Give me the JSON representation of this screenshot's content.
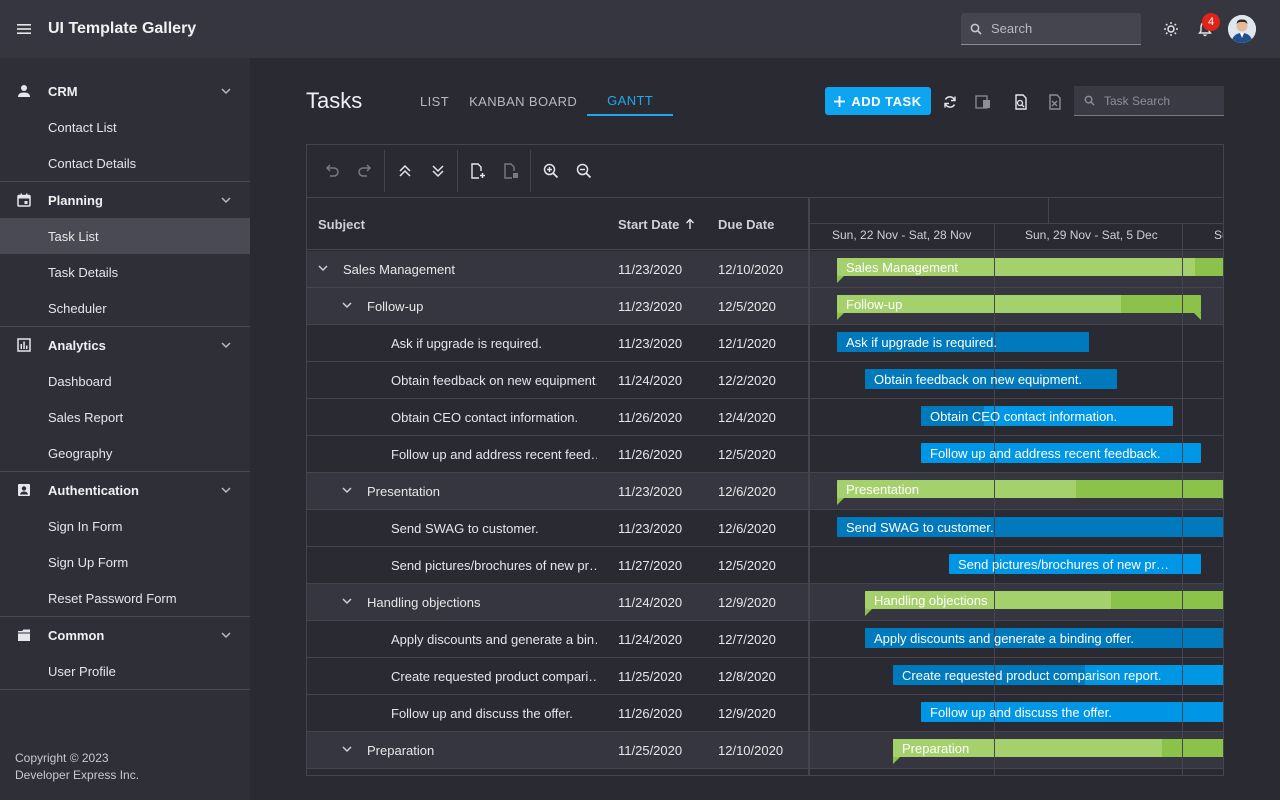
{
  "app": {
    "title": "UI Template Gallery",
    "search_placeholder": "Search",
    "notification_count": "4"
  },
  "sidebar": {
    "groups": [
      {
        "label": "CRM",
        "icon": "person-icon",
        "items": [
          {
            "label": "Contact List"
          },
          {
            "label": "Contact Details"
          }
        ]
      },
      {
        "label": "Planning",
        "icon": "calendar-icon",
        "items": [
          {
            "label": "Task List",
            "active": true
          },
          {
            "label": "Task Details"
          },
          {
            "label": "Scheduler"
          }
        ]
      },
      {
        "label": "Analytics",
        "icon": "chart-icon",
        "items": [
          {
            "label": "Dashboard"
          },
          {
            "label": "Sales Report"
          },
          {
            "label": "Geography"
          }
        ]
      },
      {
        "label": "Authentication",
        "icon": "account-box-icon",
        "items": [
          {
            "label": "Sign In Form"
          },
          {
            "label": "Sign Up Form"
          },
          {
            "label": "Reset Password Form"
          }
        ]
      },
      {
        "label": "Common",
        "icon": "folder-icon",
        "items": [
          {
            "label": "User Profile"
          }
        ]
      }
    ],
    "footer_line1": "Copyright © 2023",
    "footer_line2": "Developer Express Inc."
  },
  "page": {
    "title": "Tasks",
    "tabs": [
      {
        "label": "LIST"
      },
      {
        "label": "KANBAN BOARD"
      },
      {
        "label": "GANTT",
        "active": true
      }
    ],
    "add_task_label": "ADD TASK",
    "task_search_placeholder": "Task Search"
  },
  "gantt": {
    "columns": {
      "subject": "Subject",
      "start": "Start Date",
      "due": "Due Date"
    },
    "weeks": [
      "Sun, 22 Nov - Sat, 28 Nov",
      "Sun, 29 Nov - Sat, 5 Dec",
      "Su"
    ],
    "rows": [
      {
        "subject": "Sales Management",
        "start": "11/23/2020",
        "due": "12/10/2020",
        "level": 0,
        "summary": true,
        "bar_label": "Sales Management",
        "progress": 0.71
      },
      {
        "subject": "Follow-up",
        "start": "11/23/2020",
        "due": "12/5/2020",
        "level": 1,
        "summary": true,
        "bar_label": "Follow-up",
        "progress": 0.78
      },
      {
        "subject": "Ask if upgrade is required.",
        "start": "11/23/2020",
        "due": "12/1/2020",
        "level": 2,
        "summary": false,
        "bar_label": "Ask if upgrade is required.",
        "progress": 1.0
      },
      {
        "subject": "Obtain feedback on new equipment.",
        "start": "11/24/2020",
        "due": "12/2/2020",
        "level": 2,
        "summary": false,
        "bar_label": "Obtain feedback on new equipment.",
        "progress": 1.0
      },
      {
        "subject": "Obtain CEO contact information.",
        "start": "11/26/2020",
        "due": "12/4/2020",
        "level": 2,
        "summary": false,
        "bar_label": "Obtain CEO contact information.",
        "progress": 0.25
      },
      {
        "subject": "Follow up and address recent feed…",
        "start": "11/26/2020",
        "due": "12/5/2020",
        "level": 2,
        "summary": false,
        "bar_label": "Follow up and address recent feedback.",
        "progress": 0.0
      },
      {
        "subject": "Presentation",
        "start": "11/23/2020",
        "due": "12/6/2020",
        "level": 1,
        "summary": true,
        "bar_label": "Presentation",
        "progress": 0.61
      },
      {
        "subject": "Send SWAG to customer.",
        "start": "11/23/2020",
        "due": "12/6/2020",
        "level": 2,
        "summary": false,
        "bar_label": "Send SWAG to customer.",
        "progress": 1.0
      },
      {
        "subject": "Send pictures/brochures of new pr…",
        "start": "11/27/2020",
        "due": "12/5/2020",
        "level": 2,
        "summary": false,
        "bar_label": "Send pictures/brochures of new pr…",
        "progress": 0.0
      },
      {
        "subject": "Handling objections",
        "start": "11/24/2020",
        "due": "12/9/2020",
        "level": 1,
        "summary": true,
        "bar_label": "Handling objections",
        "progress": 0.55
      },
      {
        "subject": "Apply discounts and generate a bin…",
        "start": "11/24/2020",
        "due": "12/7/2020",
        "level": 2,
        "summary": false,
        "bar_label": "Apply discounts and generate a binding offer.",
        "progress": 1.0
      },
      {
        "subject": "Create requested product compari…",
        "start": "11/25/2020",
        "due": "12/8/2020",
        "level": 2,
        "summary": false,
        "bar_label": "Create requested product comparison report.",
        "progress": 0.49
      },
      {
        "subject": "Follow up and discuss the offer.",
        "start": "11/26/2020",
        "due": "12/9/2020",
        "level": 2,
        "summary": false,
        "bar_label": "Follow up and discuss the offer.",
        "progress": 0.0
      },
      {
        "subject": "Preparation",
        "start": "11/25/2020",
        "due": "12/10/2020",
        "level": 1,
        "summary": true,
        "bar_label": "Preparation",
        "progress": 0.6
      }
    ]
  }
}
